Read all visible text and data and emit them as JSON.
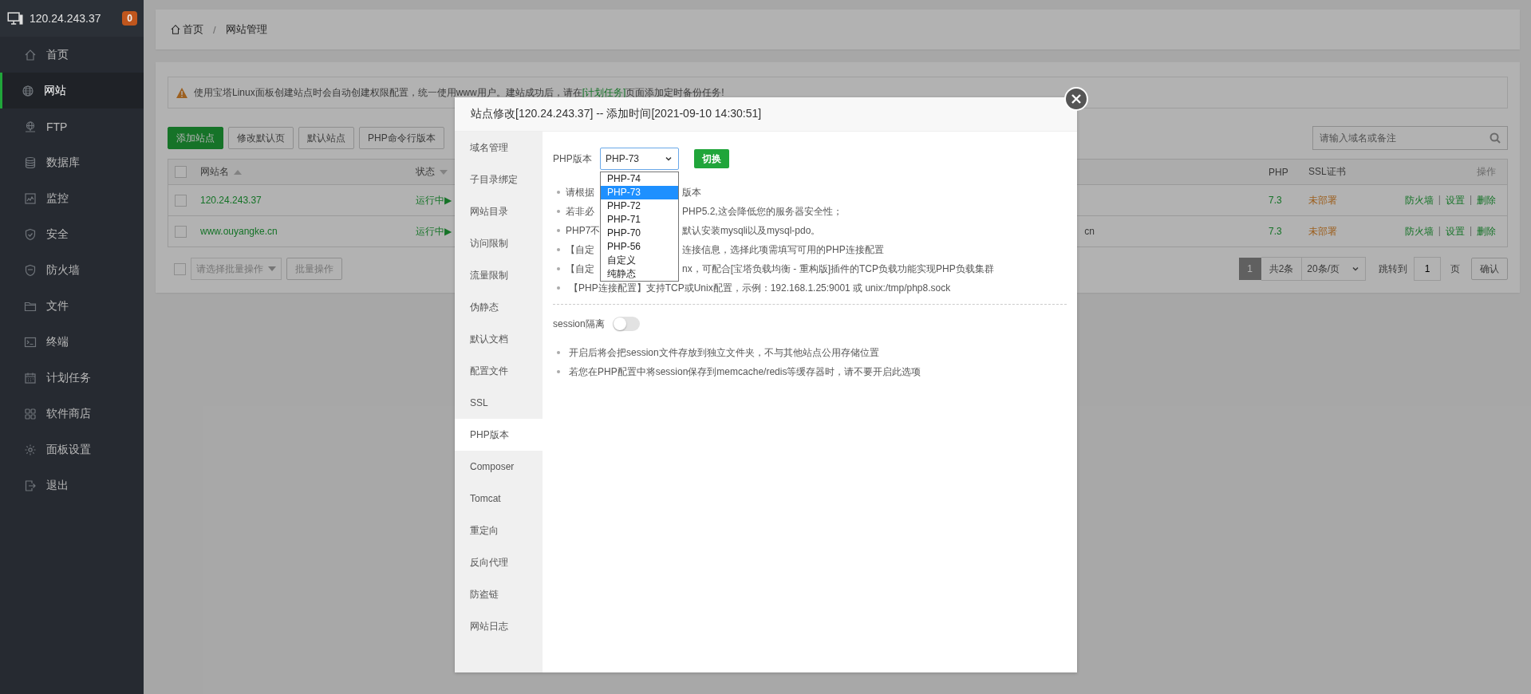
{
  "sidebar": {
    "host": "120.24.243.37",
    "badge": "0",
    "items": [
      {
        "label": "首页",
        "selected": false
      },
      {
        "label": "网站",
        "selected": true
      },
      {
        "label": "FTP",
        "selected": false
      },
      {
        "label": "数据库",
        "selected": false
      },
      {
        "label": "监控",
        "selected": false
      },
      {
        "label": "安全",
        "selected": false
      },
      {
        "label": "防火墙",
        "selected": false
      },
      {
        "label": "文件",
        "selected": false
      },
      {
        "label": "终端",
        "selected": false
      },
      {
        "label": "计划任务",
        "selected": false
      },
      {
        "label": "软件商店",
        "selected": false
      },
      {
        "label": "面板设置",
        "selected": false
      },
      {
        "label": "退出",
        "selected": false
      }
    ]
  },
  "breadcrumb": {
    "items": [
      "首页",
      "网站管理"
    ],
    "separator": "/"
  },
  "notice": {
    "before": "使用宝塔Linux面板创建站点时会自动创建权限配置，统一使用www用户。建站成功后，请在",
    "link": "[计划任务]",
    "after": "页面添加定时备份任务!"
  },
  "toolbar": [
    {
      "label": "添加站点",
      "kind": "primary"
    },
    {
      "label": "修改默认页",
      "kind": "plain"
    },
    {
      "label": "默认站点",
      "kind": "plain"
    },
    {
      "label": "PHP命令行版本",
      "kind": "plain"
    }
  ],
  "search": {
    "placeholder": "请输入域名或备注"
  },
  "table": {
    "select_all_checked": false,
    "columns": [
      {
        "label": "网站名",
        "sort_ascending": true
      },
      {
        "label": "状态",
        "sort_ascending": false
      },
      {
        "label": "PHP"
      },
      {
        "label": "SSL证书"
      },
      {
        "label": "操作"
      }
    ],
    "rows": [
      {
        "checked": false,
        "name": "120.24.243.37",
        "status": "运行中▶",
        "php": "7.3",
        "ssl": "未部署",
        "actions": [
          {
            "label": "防火墙",
            "kind": "link"
          },
          {
            "label": "|",
            "kind": "separator"
          },
          {
            "label": "设置",
            "kind": "link"
          },
          {
            "label": "|",
            "kind": "separator"
          },
          {
            "label": "删除",
            "kind": "link"
          }
        ]
      },
      {
        "checked": false,
        "name": "www.ouyangke.cn",
        "status": "运行中▶",
        "column_3": "cn",
        "php": "7.3",
        "ssl": "未部署",
        "actions": [
          {
            "label": "防火墙",
            "kind": "link"
          },
          {
            "label": "|",
            "kind": "separator"
          },
          {
            "label": "设置",
            "kind": "link"
          },
          {
            "label": "|",
            "kind": "separator"
          },
          {
            "label": "删除",
            "kind": "link"
          }
        ]
      }
    ]
  },
  "footer": {
    "select_all_checked": false,
    "batch_placeholder": "请选择批量操作",
    "batch_button": {
      "label": "批量操作",
      "disabled": true
    },
    "pages": [
      {
        "label": "1",
        "selected": true
      }
    ],
    "total": "共2条",
    "page_size": "20条/页",
    "jump_label": "跳转到",
    "jump_value": "1",
    "page_unit": "页",
    "confirm": "确认"
  },
  "modal": {
    "title": "站点修改[120.24.243.37] -- 添加时间[2021-09-10 14:30:51]",
    "nav": [
      {
        "label": "域名管理",
        "selected": false
      },
      {
        "label": "子目录绑定",
        "selected": false
      },
      {
        "label": "网站目录",
        "selected": false
      },
      {
        "label": "访问限制",
        "selected": false
      },
      {
        "label": "流量限制",
        "selected": false
      },
      {
        "label": "伪静态",
        "selected": false
      },
      {
        "label": "默认文档",
        "selected": false
      },
      {
        "label": "配置文件",
        "selected": false
      },
      {
        "label": "SSL",
        "selected": false
      },
      {
        "label": "PHP版本",
        "selected": true
      },
      {
        "label": "Composer",
        "selected": false
      },
      {
        "label": "Tomcat",
        "selected": false
      },
      {
        "label": "重定向",
        "selected": false
      },
      {
        "label": "反向代理",
        "selected": false
      },
      {
        "label": "防盗链",
        "selected": false
      },
      {
        "label": "网站日志",
        "selected": false
      }
    ],
    "php_label": "PHP版本",
    "select": {
      "value": "PHP-73",
      "open": true,
      "options": [
        {
          "label": "PHP-74",
          "selected": false
        },
        {
          "label": "PHP-73",
          "selected": true
        },
        {
          "label": "PHP-72",
          "selected": false
        },
        {
          "label": "PHP-71",
          "selected": false
        },
        {
          "label": "PHP-70",
          "selected": false
        },
        {
          "label": "PHP-56",
          "selected": false
        },
        {
          "label": "自定义",
          "selected": false
        },
        {
          "label": "纯静态",
          "selected": false
        }
      ]
    },
    "switch_button": "切换",
    "notes": [
      {
        "head": "请根据",
        "tail": "版本"
      },
      {
        "head": "若非必",
        "tail": "PHP5.2,这会降低您的服务器安全性；"
      },
      {
        "head": "PHP7不",
        "tail": "默认安装mysqli以及mysql-pdo。"
      },
      {
        "head": "【自定",
        "tail": "连接信息，选择此项需填写可用的PHP连接配置"
      },
      {
        "head": "【自定",
        "tail": "nx，可配合[宝塔负载均衡 - 重构版]插件的TCP负载功能实现PHP负载集群"
      },
      {
        "text": "【PHP连接配置】支持TCP或Unix配置，示例：192.168.1.25:9001 或 unix:/tmp/php8.sock"
      }
    ],
    "session": {
      "label": "session隔离",
      "on": false
    },
    "session_notes": [
      "开启后将会把session文件存放到独立文件夹，不与其他站点公用存储位置",
      "若您在PHP配置中将session保存到memcache/redis等缓存器时，请不要开启此选项"
    ]
  }
}
